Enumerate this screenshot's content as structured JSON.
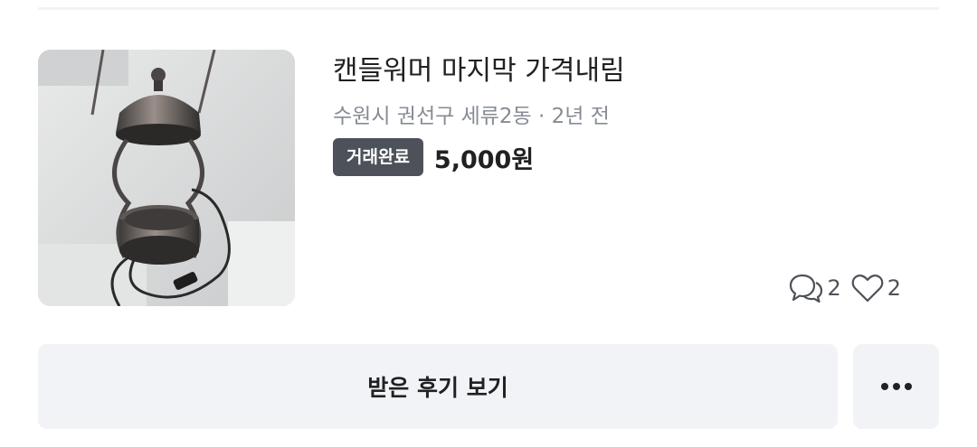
{
  "listing": {
    "title": "캔들워머 마지막 가격내림",
    "location": "수원시 권선구 세류2동",
    "separator": " · ",
    "time_ago": "2년 전",
    "status_badge": "거래완료",
    "price": "5,000원",
    "chat_count": "2",
    "like_count": "2",
    "image_subject": "candle-warmer-lamp"
  },
  "actions": {
    "review_label": "받은 후기 보기",
    "more_icon": "more-horizontal-icon"
  },
  "colors": {
    "badge_bg": "#4d5159",
    "button_bg": "#f2f3f6",
    "meta_text": "#868b94",
    "primary_text": "#212124"
  }
}
